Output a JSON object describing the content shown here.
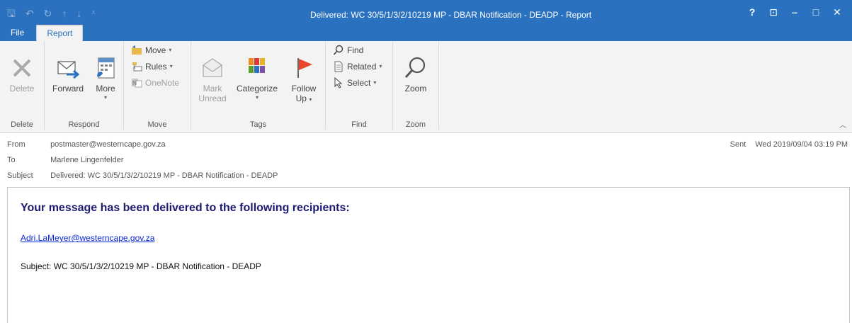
{
  "window": {
    "title": "Delivered: WC 30/5/1/3/2/10219 MP - DBAR Notification - DEADP - Report",
    "help": "?",
    "ribbon_display": "⊡",
    "minimize": "–",
    "maximize": "□",
    "close": "✕"
  },
  "qat": {
    "save": "🖫",
    "undo": "↶",
    "redo": "↻",
    "up": "↑",
    "down": "↓",
    "customize": "⩡"
  },
  "tabs": {
    "file": "File",
    "report": "Report"
  },
  "ribbon": {
    "delete": {
      "button": "Delete",
      "group": "Delete"
    },
    "respond": {
      "forward": "Forward",
      "more": "More",
      "group": "Respond"
    },
    "move": {
      "move": "Move",
      "rules": "Rules",
      "onenote": "OneNote",
      "group": "Move"
    },
    "tags": {
      "mark_unread_1": "Mark",
      "mark_unread_2": "Unread",
      "categorize": "Categorize",
      "follow_up_1": "Follow",
      "follow_up_2": "Up",
      "group": "Tags"
    },
    "find": {
      "find": "Find",
      "related": "Related",
      "select": "Select",
      "group": "Find"
    },
    "zoom": {
      "zoom": "Zoom",
      "group": "Zoom"
    }
  },
  "header": {
    "from_label": "From",
    "from": "postmaster@westerncape.gov.za",
    "to_label": "To",
    "to": "Marlene Lingenfelder",
    "subject_label": "Subject",
    "subject": "Delivered: WC 30/5/1/3/2/10219 MP - DBAR Notification - DEADP",
    "sent_label": "Sent",
    "sent": "Wed 2019/09/04 03:19 PM"
  },
  "body": {
    "heading": "Your message has been delivered to the following recipients:",
    "recipient": "Adri.LaMeyer@westerncape.gov.za",
    "subject_line": "Subject: WC 30/5/1/3/2/10219 MP - DBAR Notification - DEADP"
  }
}
